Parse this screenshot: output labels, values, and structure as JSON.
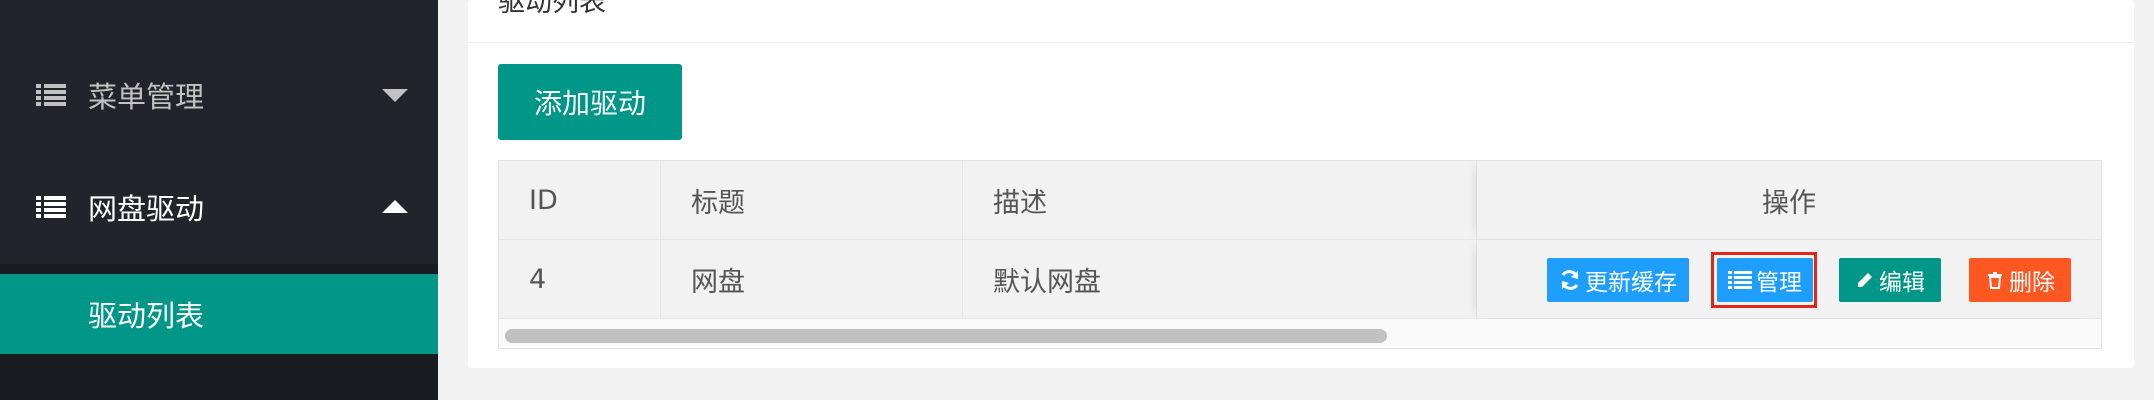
{
  "sidebar": {
    "items": [
      {
        "label": "菜单管理",
        "icon": "list-icon",
        "caret": "chevron-down-icon"
      },
      {
        "label": "网盘驱动",
        "icon": "list-icon",
        "caret": "chevron-up-icon"
      }
    ],
    "sub_items": [
      {
        "label": "驱动列表"
      }
    ]
  },
  "card": {
    "title": "驱动列表",
    "add_button": "添加驱动"
  },
  "table": {
    "headers": [
      "ID",
      "标题",
      "描述",
      "操作"
    ],
    "rows": [
      {
        "id": "4",
        "title": "网盘",
        "desc": "默认网盘",
        "actions": {
          "refresh": "更新缓存",
          "manage": "管理",
          "edit": "编辑",
          "delete": "删除"
        }
      }
    ]
  },
  "colors": {
    "sidebar_bg": "#23232c",
    "accent_teal": "#009688",
    "accent_blue": "#1e9fff",
    "accent_orange": "#ff5722",
    "highlight_red": "#e0271a"
  }
}
